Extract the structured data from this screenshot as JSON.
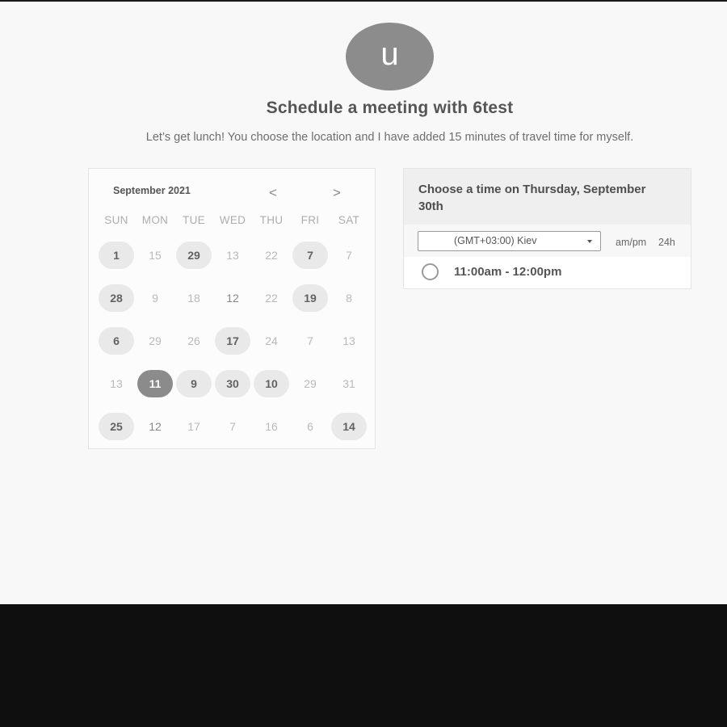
{
  "avatar": {
    "initial": "u"
  },
  "header": {
    "title": "Schedule a meeting with 6test",
    "subtitle": "Let’s get lunch! You choose the location and I have added 15 minutes of travel time for myself."
  },
  "calendar": {
    "month_label": "September 2021",
    "prev_label": "<",
    "next_label": ">",
    "weekdays": [
      "SUN",
      "MON",
      "TUE",
      "WED",
      "THU",
      "FRI",
      "SAT"
    ],
    "weeks": [
      [
        {
          "label": "1",
          "state": "available"
        },
        {
          "label": "15",
          "state": "disabled"
        },
        {
          "label": "29",
          "state": "available"
        },
        {
          "label": "13",
          "state": "disabled"
        },
        {
          "label": "22",
          "state": "disabled"
        },
        {
          "label": "7",
          "state": "available"
        },
        {
          "label": "7",
          "state": "disabled"
        }
      ],
      [
        {
          "label": "28",
          "state": "available"
        },
        {
          "label": "9",
          "state": "disabled"
        },
        {
          "label": "18",
          "state": "disabled"
        },
        {
          "label": "12",
          "state": "muted"
        },
        {
          "label": "22",
          "state": "disabled"
        },
        {
          "label": "19",
          "state": "available"
        },
        {
          "label": "8",
          "state": "disabled"
        }
      ],
      [
        {
          "label": "6",
          "state": "available"
        },
        {
          "label": "29",
          "state": "disabled"
        },
        {
          "label": "26",
          "state": "disabled"
        },
        {
          "label": "17",
          "state": "available"
        },
        {
          "label": "24",
          "state": "disabled"
        },
        {
          "label": "7",
          "state": "disabled"
        },
        {
          "label": "13",
          "state": "disabled"
        }
      ],
      [
        {
          "label": "13",
          "state": "disabled"
        },
        {
          "label": "11",
          "state": "selected"
        },
        {
          "label": "9",
          "state": "available"
        },
        {
          "label": "30",
          "state": "available"
        },
        {
          "label": "10",
          "state": "available"
        },
        {
          "label": "29",
          "state": "disabled"
        },
        {
          "label": "31",
          "state": "disabled"
        }
      ],
      [
        {
          "label": "25",
          "state": "available"
        },
        {
          "label": "12",
          "state": "muted"
        },
        {
          "label": "17",
          "state": "disabled"
        },
        {
          "label": "7",
          "state": "disabled"
        },
        {
          "label": "16",
          "state": "disabled"
        },
        {
          "label": "6",
          "state": "disabled"
        },
        {
          "label": "14",
          "state": "available"
        }
      ]
    ]
  },
  "time_panel": {
    "title": "Choose a time on Thursday, September 30th",
    "timezone": "(GMT+03:00) Kiev",
    "format_ampm": "am/pm",
    "format_24h": "24h",
    "slots": [
      {
        "label": "11:00am - 12:00pm"
      }
    ]
  },
  "colors": {
    "page_background": "#f8f8f8",
    "outer_background": "#0f0f0f",
    "available_day": "#e9e9e9",
    "selected_day": "#8b8b8b",
    "avatar": "#8c8c8c"
  }
}
